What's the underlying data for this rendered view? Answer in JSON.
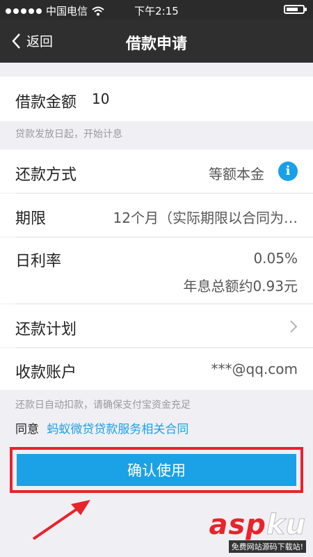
{
  "status": {
    "carrier": "中国电信",
    "time": "下午2:15"
  },
  "nav": {
    "back_label": "返回",
    "title": "借款申请"
  },
  "amount": {
    "label": "借款金额",
    "value": "10",
    "note": "贷款发放日起，开始计息"
  },
  "repay_method": {
    "label": "还款方式",
    "value": "等额本金",
    "icon": "info-icon"
  },
  "term": {
    "label": "期限",
    "value": "12个月（实际期限以合同为…"
  },
  "daily_rate": {
    "label": "日利率",
    "value": "0.05%",
    "total_interest": "年息总额约0.93元"
  },
  "repay_plan": {
    "label": "还款计划",
    "icon": "chevron-right-icon"
  },
  "account": {
    "label": "收款账户",
    "value": "***@qq.com"
  },
  "auto_deduct_note": "还款日自动扣款，请确保支付宝资金充足",
  "agree": {
    "prefix": "同意",
    "link": "蚂蚁微贷贷款服务相关合同"
  },
  "confirm_button": "确认使用",
  "watermark": {
    "prefix": "asp",
    "highlight": "ku",
    "tagline": "免费网站源码下载站!"
  },
  "colors": {
    "accent": "#1ba1e6",
    "nav_bg": "#2f2f2f",
    "highlight_border": "#e8232a",
    "arrow": "#e8232a"
  }
}
